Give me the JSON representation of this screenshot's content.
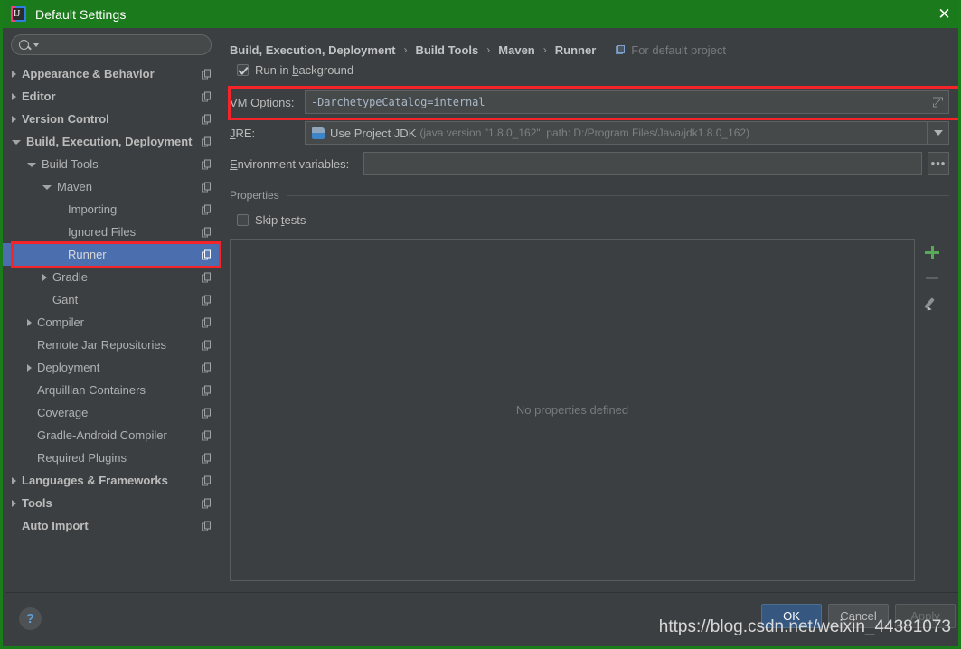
{
  "window": {
    "title": "Default Settings",
    "close_label": "✕",
    "app_icon": "intellij-idea-icon"
  },
  "sidebar": {
    "search": {
      "placeholder": "",
      "value": "",
      "icon": "search-icon"
    },
    "items": [
      {
        "label": "Appearance & Behavior",
        "indent": 0,
        "arrow": "right",
        "bold": true,
        "selected": false
      },
      {
        "label": "Editor",
        "indent": 0,
        "arrow": "right",
        "bold": true,
        "selected": false
      },
      {
        "label": "Version Control",
        "indent": 0,
        "arrow": "right",
        "bold": true,
        "selected": false
      },
      {
        "label": "Build, Execution, Deployment",
        "indent": 0,
        "arrow": "down",
        "bold": true,
        "selected": false
      },
      {
        "label": "Build Tools",
        "indent": 1,
        "arrow": "down",
        "bold": false,
        "selected": false
      },
      {
        "label": "Maven",
        "indent": 2,
        "arrow": "down",
        "bold": false,
        "selected": false
      },
      {
        "label": "Importing",
        "indent": 3,
        "arrow": "none",
        "bold": false,
        "selected": false
      },
      {
        "label": "Ignored Files",
        "indent": 3,
        "arrow": "none",
        "bold": false,
        "selected": false
      },
      {
        "label": "Runner",
        "indent": 3,
        "arrow": "none",
        "bold": false,
        "selected": true
      },
      {
        "label": "Gradle",
        "indent": 2,
        "arrow": "right",
        "bold": false,
        "selected": false
      },
      {
        "label": "Gant",
        "indent": 2,
        "arrow": "none",
        "bold": false,
        "selected": false
      },
      {
        "label": "Compiler",
        "indent": 1,
        "arrow": "right",
        "bold": false,
        "selected": false
      },
      {
        "label": "Remote Jar Repositories",
        "indent": 1,
        "arrow": "none",
        "bold": false,
        "selected": false
      },
      {
        "label": "Deployment",
        "indent": 1,
        "arrow": "right",
        "bold": false,
        "selected": false
      },
      {
        "label": "Arquillian Containers",
        "indent": 1,
        "arrow": "none",
        "bold": false,
        "selected": false
      },
      {
        "label": "Coverage",
        "indent": 1,
        "arrow": "none",
        "bold": false,
        "selected": false
      },
      {
        "label": "Gradle-Android Compiler",
        "indent": 1,
        "arrow": "none",
        "bold": false,
        "selected": false
      },
      {
        "label": "Required Plugins",
        "indent": 1,
        "arrow": "none",
        "bold": false,
        "selected": false
      },
      {
        "label": "Languages & Frameworks",
        "indent": 0,
        "arrow": "right",
        "bold": true,
        "selected": false
      },
      {
        "label": "Tools",
        "indent": 0,
        "arrow": "right",
        "bold": true,
        "selected": false
      },
      {
        "label": "Auto Import",
        "indent": 0,
        "arrow": "none",
        "bold": true,
        "selected": false
      }
    ]
  },
  "content": {
    "breadcrumb": {
      "parts": [
        "Build, Execution, Deployment",
        "Build Tools",
        "Maven",
        "Runner"
      ],
      "separator": "›",
      "note": "For default project",
      "note_icon": "project-scope-icon"
    },
    "run_in_background": {
      "label_pre": "Run in ",
      "label_mnemonic": "b",
      "label_post": "ackground",
      "checked": true
    },
    "vm_options": {
      "label_mnemonic": "V",
      "label_rest": "M Options:",
      "value": "-DarchetypeCatalog=internal",
      "expand_icon": "expand-icon"
    },
    "jre": {
      "label_mnemonic": "J",
      "label_rest": "RE:",
      "value_main": "Use Project JDK",
      "value_detail": "(java version \"1.8.0_162\", path: D:/Program Files/Java/jdk1.8.0_162)",
      "icon": "jdk-icon",
      "arrow_icon": "chevron-down-icon"
    },
    "environment_variables": {
      "label_mnemonic": "E",
      "label_rest": "nvironment variables:",
      "value": "",
      "browse_label": "•••"
    },
    "properties": {
      "group_title": "Properties",
      "skip_tests": {
        "label_pre": "Skip ",
        "label_mnemonic": "t",
        "label_post": "ests",
        "checked": false
      },
      "empty_text": "No properties defined",
      "toolbar": {
        "add": "add-icon",
        "remove": "remove-icon",
        "edit": "edit-icon"
      }
    }
  },
  "footer": {
    "help_label": "?",
    "ok_label": "OK",
    "cancel_label": "Cancel",
    "apply_label": "Apply"
  },
  "watermark": "https://blog.csdn.net/weixin_44381073",
  "colors": {
    "titlebar": "#1b7a1b",
    "selection": "#4b6eaf",
    "annotation": "#f5242a",
    "panel": "#3c3f41",
    "accent_ok": "#365880"
  }
}
